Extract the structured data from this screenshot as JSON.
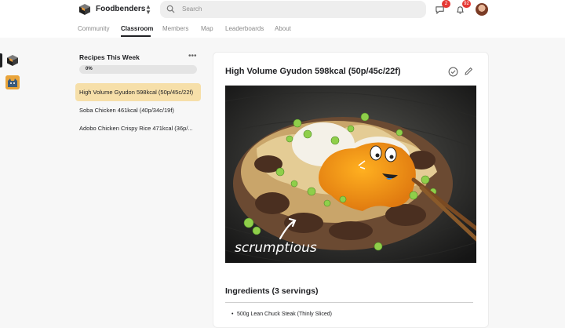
{
  "header": {
    "brand": "Foodbenders",
    "search_placeholder": "Search",
    "chat_badge": "2",
    "notif_badge": "92",
    "tabs": [
      {
        "label": "Community",
        "active": false
      },
      {
        "label": "Classroom",
        "active": true
      },
      {
        "label": "Members",
        "active": false
      },
      {
        "label": "Map",
        "active": false
      },
      {
        "label": "Leaderboards",
        "active": false
      },
      {
        "label": "About",
        "active": false
      }
    ]
  },
  "course": {
    "title": "Recipes This Week",
    "progress_label": "0%",
    "progress_value": 0,
    "lessons": [
      {
        "label": "High Volume Gyudon 598kcal (50p/45c/22f)",
        "selected": true
      },
      {
        "label": "Soba Chicken 461kcal (40p/34c/19f)",
        "selected": false
      },
      {
        "label": "Adobo Chicken Crispy Rice 471kcal (36p/...",
        "selected": false
      }
    ]
  },
  "post": {
    "title": "High Volume Gyudon 598kcal (50p/45c/22f)",
    "image_caption": "scrumptious",
    "ingredients_title": "Ingredients (3 servings)",
    "ingredients": [
      "500g Lean Chuck Steak (Thinly Sliced)"
    ]
  },
  "colors": {
    "accent_selected": "#f6dfa9",
    "badge": "#e53935",
    "text": "#202124"
  },
  "icons": {
    "search": "search-icon",
    "chat": "chat-icon",
    "bell": "bell-icon",
    "check": "check-circle-icon",
    "edit": "pencil-icon"
  }
}
